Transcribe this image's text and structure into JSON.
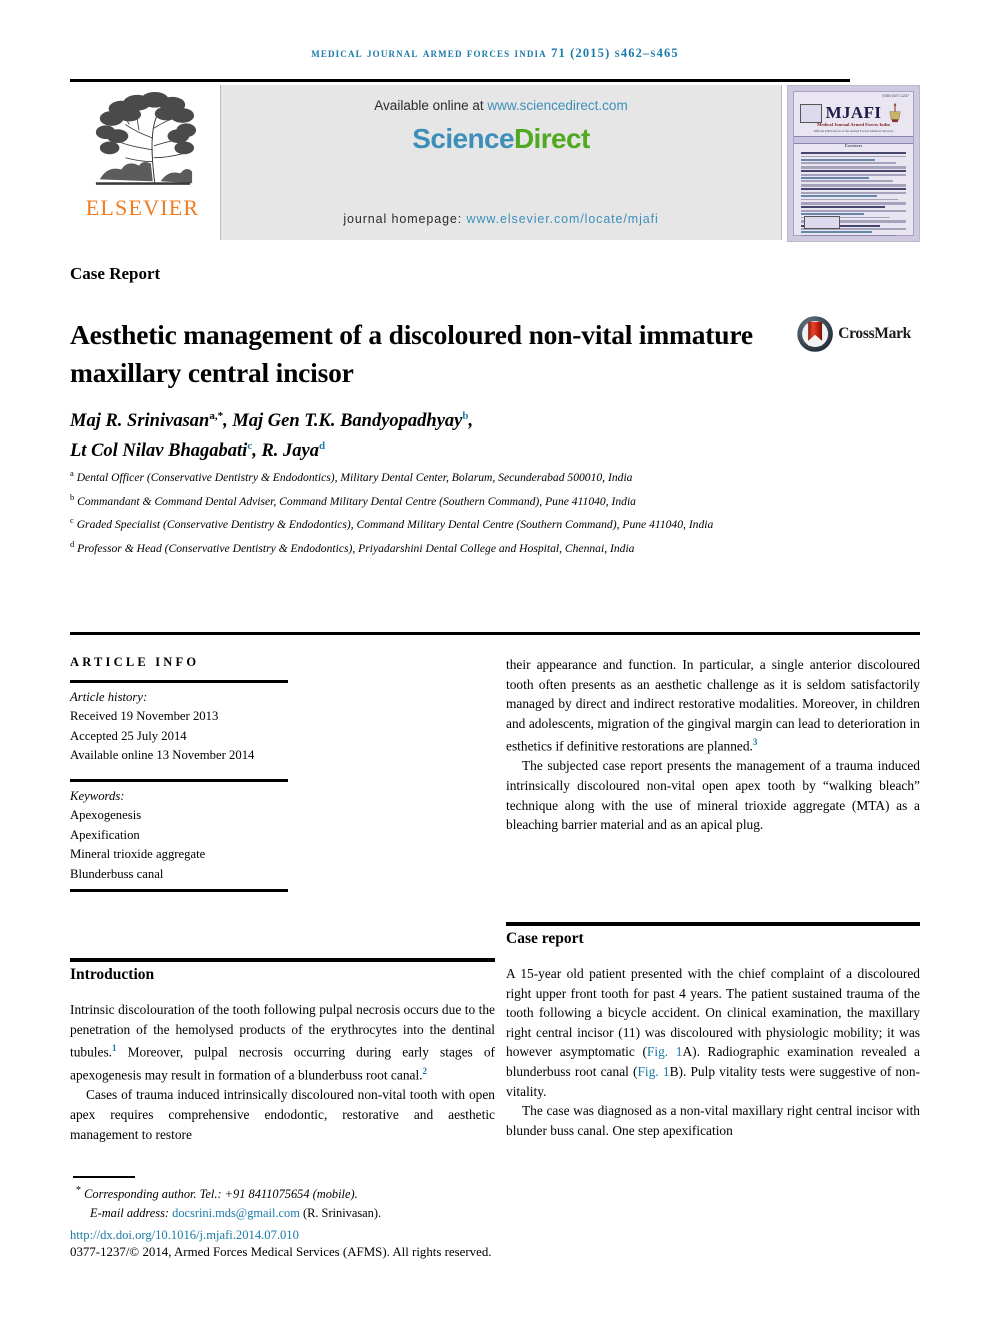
{
  "running_head": "Medical Journal Armed Forces India 71 (2015) S462–S465",
  "masthead": {
    "publisher_name": "ELSEVIER",
    "available_prefix": "Available online at ",
    "sciencedirect_url": "www.sciencedirect.com",
    "sciencedirect_logo_part1": "Science",
    "sciencedirect_logo_part2": "Direct",
    "homepage_prefix": "journal homepage: ",
    "homepage_url": "www.elsevier.com/locate/mjafi",
    "cover": {
      "title": "MJAFI",
      "subtitle": "Medical Journal Armed Forces India",
      "subtitle2": "Official Publication of the Armed Forces Medical Services",
      "issn": "ISSN 0377-1237",
      "contents_label": "Contents"
    }
  },
  "article": {
    "type": "Case Report",
    "title": "Aesthetic management of a discoloured non-vital immature maxillary central incisor",
    "crossmark_label": "CrossMark",
    "authors_line1": "Maj R. Srinivasan",
    "authors_line1_sup": "a,*",
    "authors_line1b": ", Maj Gen T.K. Bandyopadhyay",
    "authors_line1b_sup": "b",
    "authors_line1c": ",",
    "authors_line2": "Lt Col Nilav Bhagabati",
    "authors_line2_sup": "c",
    "authors_line2b": ", R. Jaya",
    "authors_line2b_sup": "d",
    "affiliations": [
      {
        "marker": "a",
        "text": "Dental Officer (Conservative Dentistry & Endodontics), Military Dental Center, Bolarum, Secunderabad 500010, India"
      },
      {
        "marker": "b",
        "text": "Commandant & Command Dental Adviser, Command Military Dental Centre (Southern Command), Pune 411040, India"
      },
      {
        "marker": "c",
        "text": "Graded Specialist (Conservative Dentistry & Endodontics), Command Military Dental Centre (Southern Command), Pune 411040, India"
      },
      {
        "marker": "d",
        "text": "Professor & Head (Conservative Dentistry & Endodontics), Priyadarshini Dental College and Hospital, Chennai, India"
      }
    ]
  },
  "article_info": {
    "heading": "ARTICLE INFO",
    "history_label": "Article history:",
    "received": "Received 19 November 2013",
    "accepted": "Accepted 25 July 2014",
    "available_online": "Available online 13 November 2014",
    "keywords_label": "Keywords:",
    "keywords": [
      "Apexogenesis",
      "Apexification",
      "Mineral trioxide aggregate",
      "Blunderbuss canal"
    ]
  },
  "abstract_continuation": {
    "p1_a": "their appearance and function. In particular, a single anterior discoloured tooth often presents as an aesthetic challenge as it is seldom satisfactorily managed by direct and indirect restorative modalities. Moreover, in children and adolescents, migration of the gingival margin can lead to deterioration in esthetics if definitive restorations are planned.",
    "p1_ref": "3",
    "p2": "The subjected case report presents the management of a trauma induced intrinsically discoloured non-vital open apex tooth by “walking bleach” technique along with the use of mineral trioxide aggregate (MTA) as a bleaching barrier material and as an apical plug."
  },
  "introduction": {
    "heading": "Introduction",
    "p1_a": "Intrinsic discolouration of the tooth following pulpal necrosis occurs due to the penetration of the hemolysed products of the erythrocytes into the dentinal tubules.",
    "p1_ref1": "1",
    "p1_b": " Moreover, pulpal necrosis occurring during early stages of apexogenesis may result in formation of a blunderbuss root canal.",
    "p1_ref2": "2",
    "p2": "Cases of trauma induced intrinsically discoloured non-vital tooth with open apex requires comprehensive endodontic, restorative and aesthetic management to restore"
  },
  "case_report": {
    "heading": "Case report",
    "p1_a": "A 15-year old patient presented with the chief complaint of a discoloured right upper front tooth for past 4 years. The patient sustained trauma of the tooth following a bicycle accident. On clinical examination, the maxillary right central incisor (11) was discoloured with physiologic mobility; it was however asymptomatic (",
    "p1_fig1": "Fig. 1",
    "p1_b": "A). Radiographic examination revealed a blunderbuss root canal (",
    "p1_fig2": "Fig. 1",
    "p1_c": "B). Pulp vitality tests were suggestive of non-vitality.",
    "p2": "The case was diagnosed as a non-vital maxillary right central incisor with blunder buss canal. One step apexification"
  },
  "footer": {
    "corresponding_author": "Corresponding author. Tel.: +91 8411075654 (mobile).",
    "email_label": "E-mail address: ",
    "email": "docsrini.mds@gmail.com",
    "email_owner": " (R. Srinivasan).",
    "doi": "http://dx.doi.org/10.1016/j.mjafi.2014.07.010",
    "copyright": "0377-1237/© 2014, Armed Forces Medical Services (AFMS). All rights reserved."
  },
  "colors": {
    "link_blue": "#1a7aa8",
    "elsevier_orange": "#f07c21",
    "sciencedirect_green": "#4faa21",
    "sciencedirect_blue": "#3d8fb9"
  }
}
